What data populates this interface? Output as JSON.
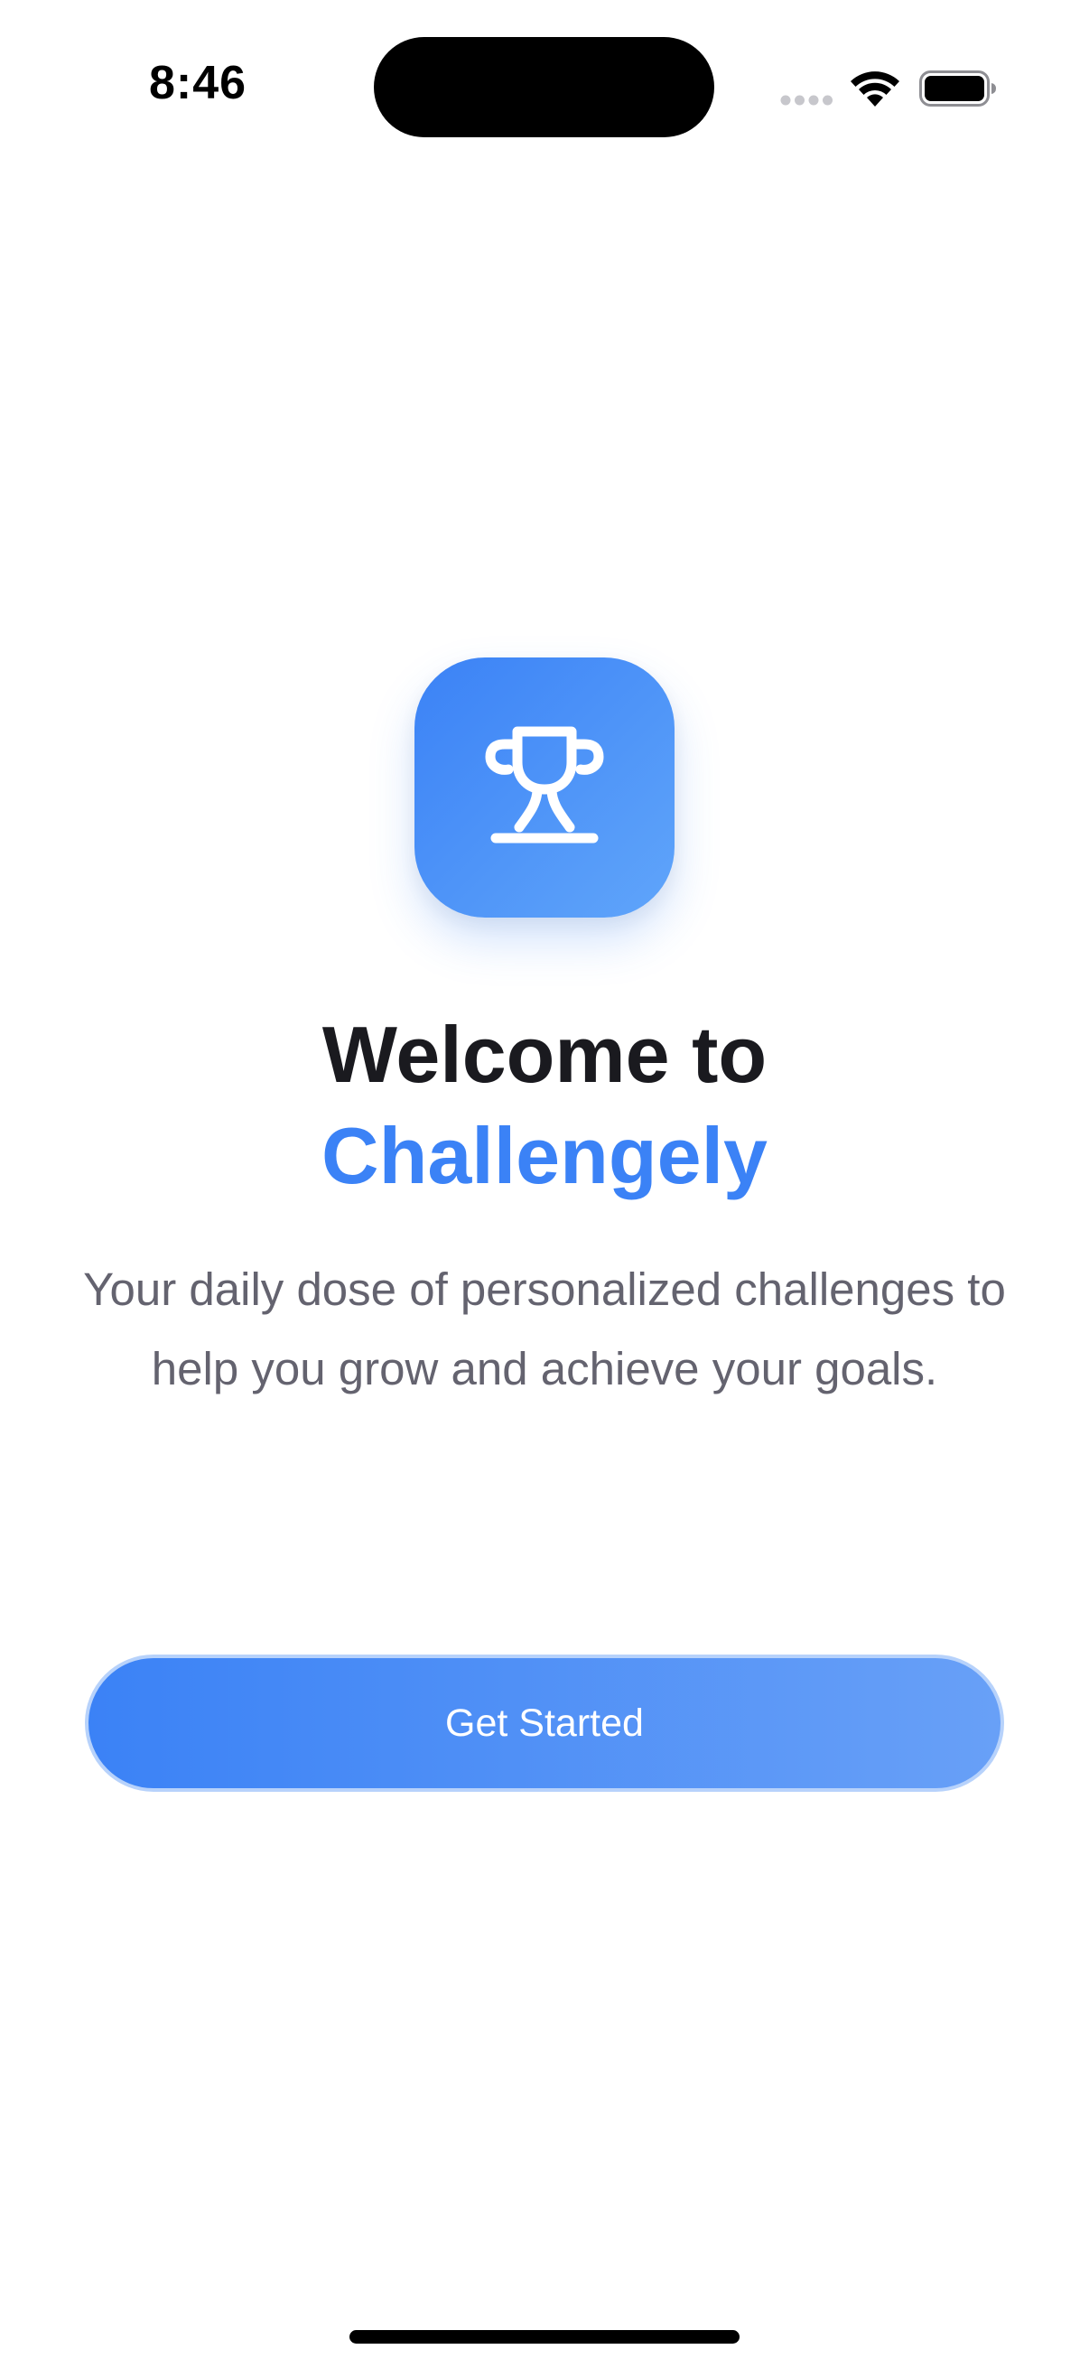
{
  "status_bar": {
    "time": "8:46",
    "icons": [
      "signal-icon",
      "wifi-icon",
      "battery-icon"
    ]
  },
  "app_icon": {
    "icon": "trophy-icon",
    "gradient_start": "#3b82f6",
    "gradient_end": "#60a5fa"
  },
  "welcome": {
    "title_line1": "Welcome to",
    "title_line2": "Challengely",
    "subtitle": "Your daily dose of personalized challenges to help you grow and achieve your goals."
  },
  "actions": {
    "get_started_label": "Get Started"
  },
  "colors": {
    "accent": "#3b82f6",
    "title": "#1a1a1f",
    "subtitle": "#64636f",
    "background": "#ffffff"
  }
}
